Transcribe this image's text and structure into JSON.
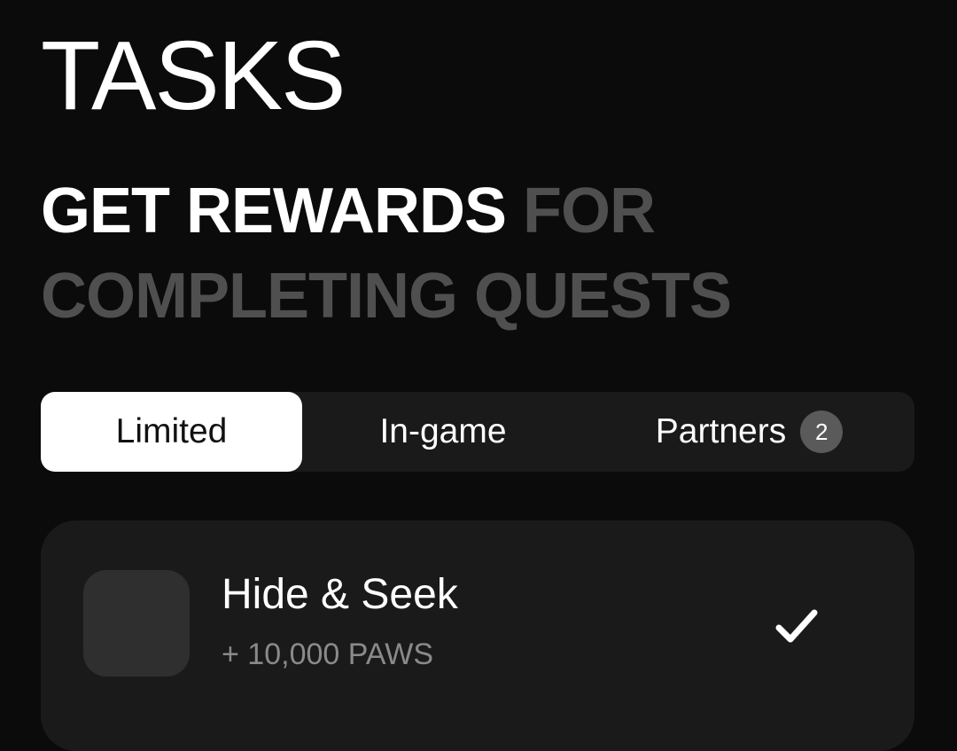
{
  "header": {
    "title": "TASKS",
    "subtitle_highlight": "GET REWARDS",
    "subtitle_rest": "FOR COMPLETING QUESTS"
  },
  "tabs": [
    {
      "label": "Limited",
      "active": true
    },
    {
      "label": "In-game",
      "active": false
    },
    {
      "label": "Partners",
      "active": false,
      "badge": "2"
    }
  ],
  "tasks": [
    {
      "title": "Hide & Seek",
      "reward": "+ 10,000 PAWS",
      "status_icon": "check-icon",
      "completed": true
    }
  ],
  "colors": {
    "background": "#0b0b0b",
    "surface": "#1a1a1a",
    "active_tab": "#ffffff",
    "dim_text": "#4f4f4f",
    "secondary_text": "#8a8a8a",
    "badge": "#5a5a5a"
  }
}
